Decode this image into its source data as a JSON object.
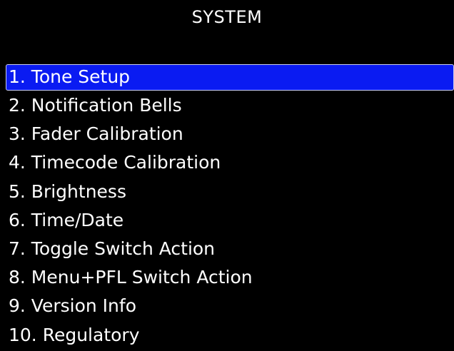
{
  "screen": {
    "title": "SYSTEM",
    "accent_color": "#0a1bf2",
    "background_color": "#000000",
    "text_color": "#ffffff"
  },
  "menu": {
    "selected_index": 0,
    "items": [
      {
        "label": "1. Tone Setup"
      },
      {
        "label": "2. Notification Bells"
      },
      {
        "label": "3. Fader Calibration"
      },
      {
        "label": "4. Timecode Calibration"
      },
      {
        "label": "5. Brightness"
      },
      {
        "label": "6. Time/Date"
      },
      {
        "label": "7. Toggle Switch Action"
      },
      {
        "label": "8. Menu+PFL Switch Action"
      },
      {
        "label": "9. Version Info"
      },
      {
        "label": "10. Regulatory"
      }
    ]
  }
}
